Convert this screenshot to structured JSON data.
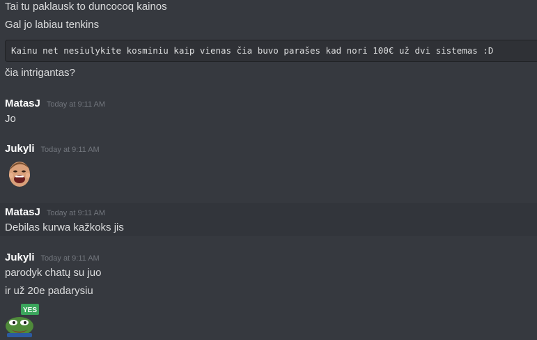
{
  "messages": {
    "m1": "Tai tu paklausk to duncocoq kainos",
    "m2": "Gal jo labiau tenkins",
    "code": "Kainu net nesiulykite kosminiu kaip vienas čia buvo parašes kad nori 100€ už dvi sistemas :D",
    "m3": "čia intrigantas?",
    "g1": {
      "user": "MatasJ",
      "time": "Today at 9:11 AM",
      "text": "Jo"
    },
    "g2": {
      "user": "Jukyli",
      "time": "Today at 9:11 AM",
      "emoji": "laughing-kid-emoji"
    },
    "g3": {
      "user": "MatasJ",
      "time": "Today at 9:11 AM",
      "text": "Debilas kurwa kažkoks jis"
    },
    "g4": {
      "user": "Jukyli",
      "time": "Today at 9:11 AM",
      "text1": "parodyk chatų su juo",
      "text2": "ir už 20e padarysiu",
      "emoji": "pepe-yes-emoji",
      "emoji_label": "YES"
    }
  },
  "colors": {
    "background": "#36393f",
    "text": "#dcddde",
    "username": "#ffffff",
    "timestamp": "#72767d",
    "code_bg": "#2f3136",
    "hover_bg": "#32353b",
    "yes_badge": "#3ba55c"
  }
}
